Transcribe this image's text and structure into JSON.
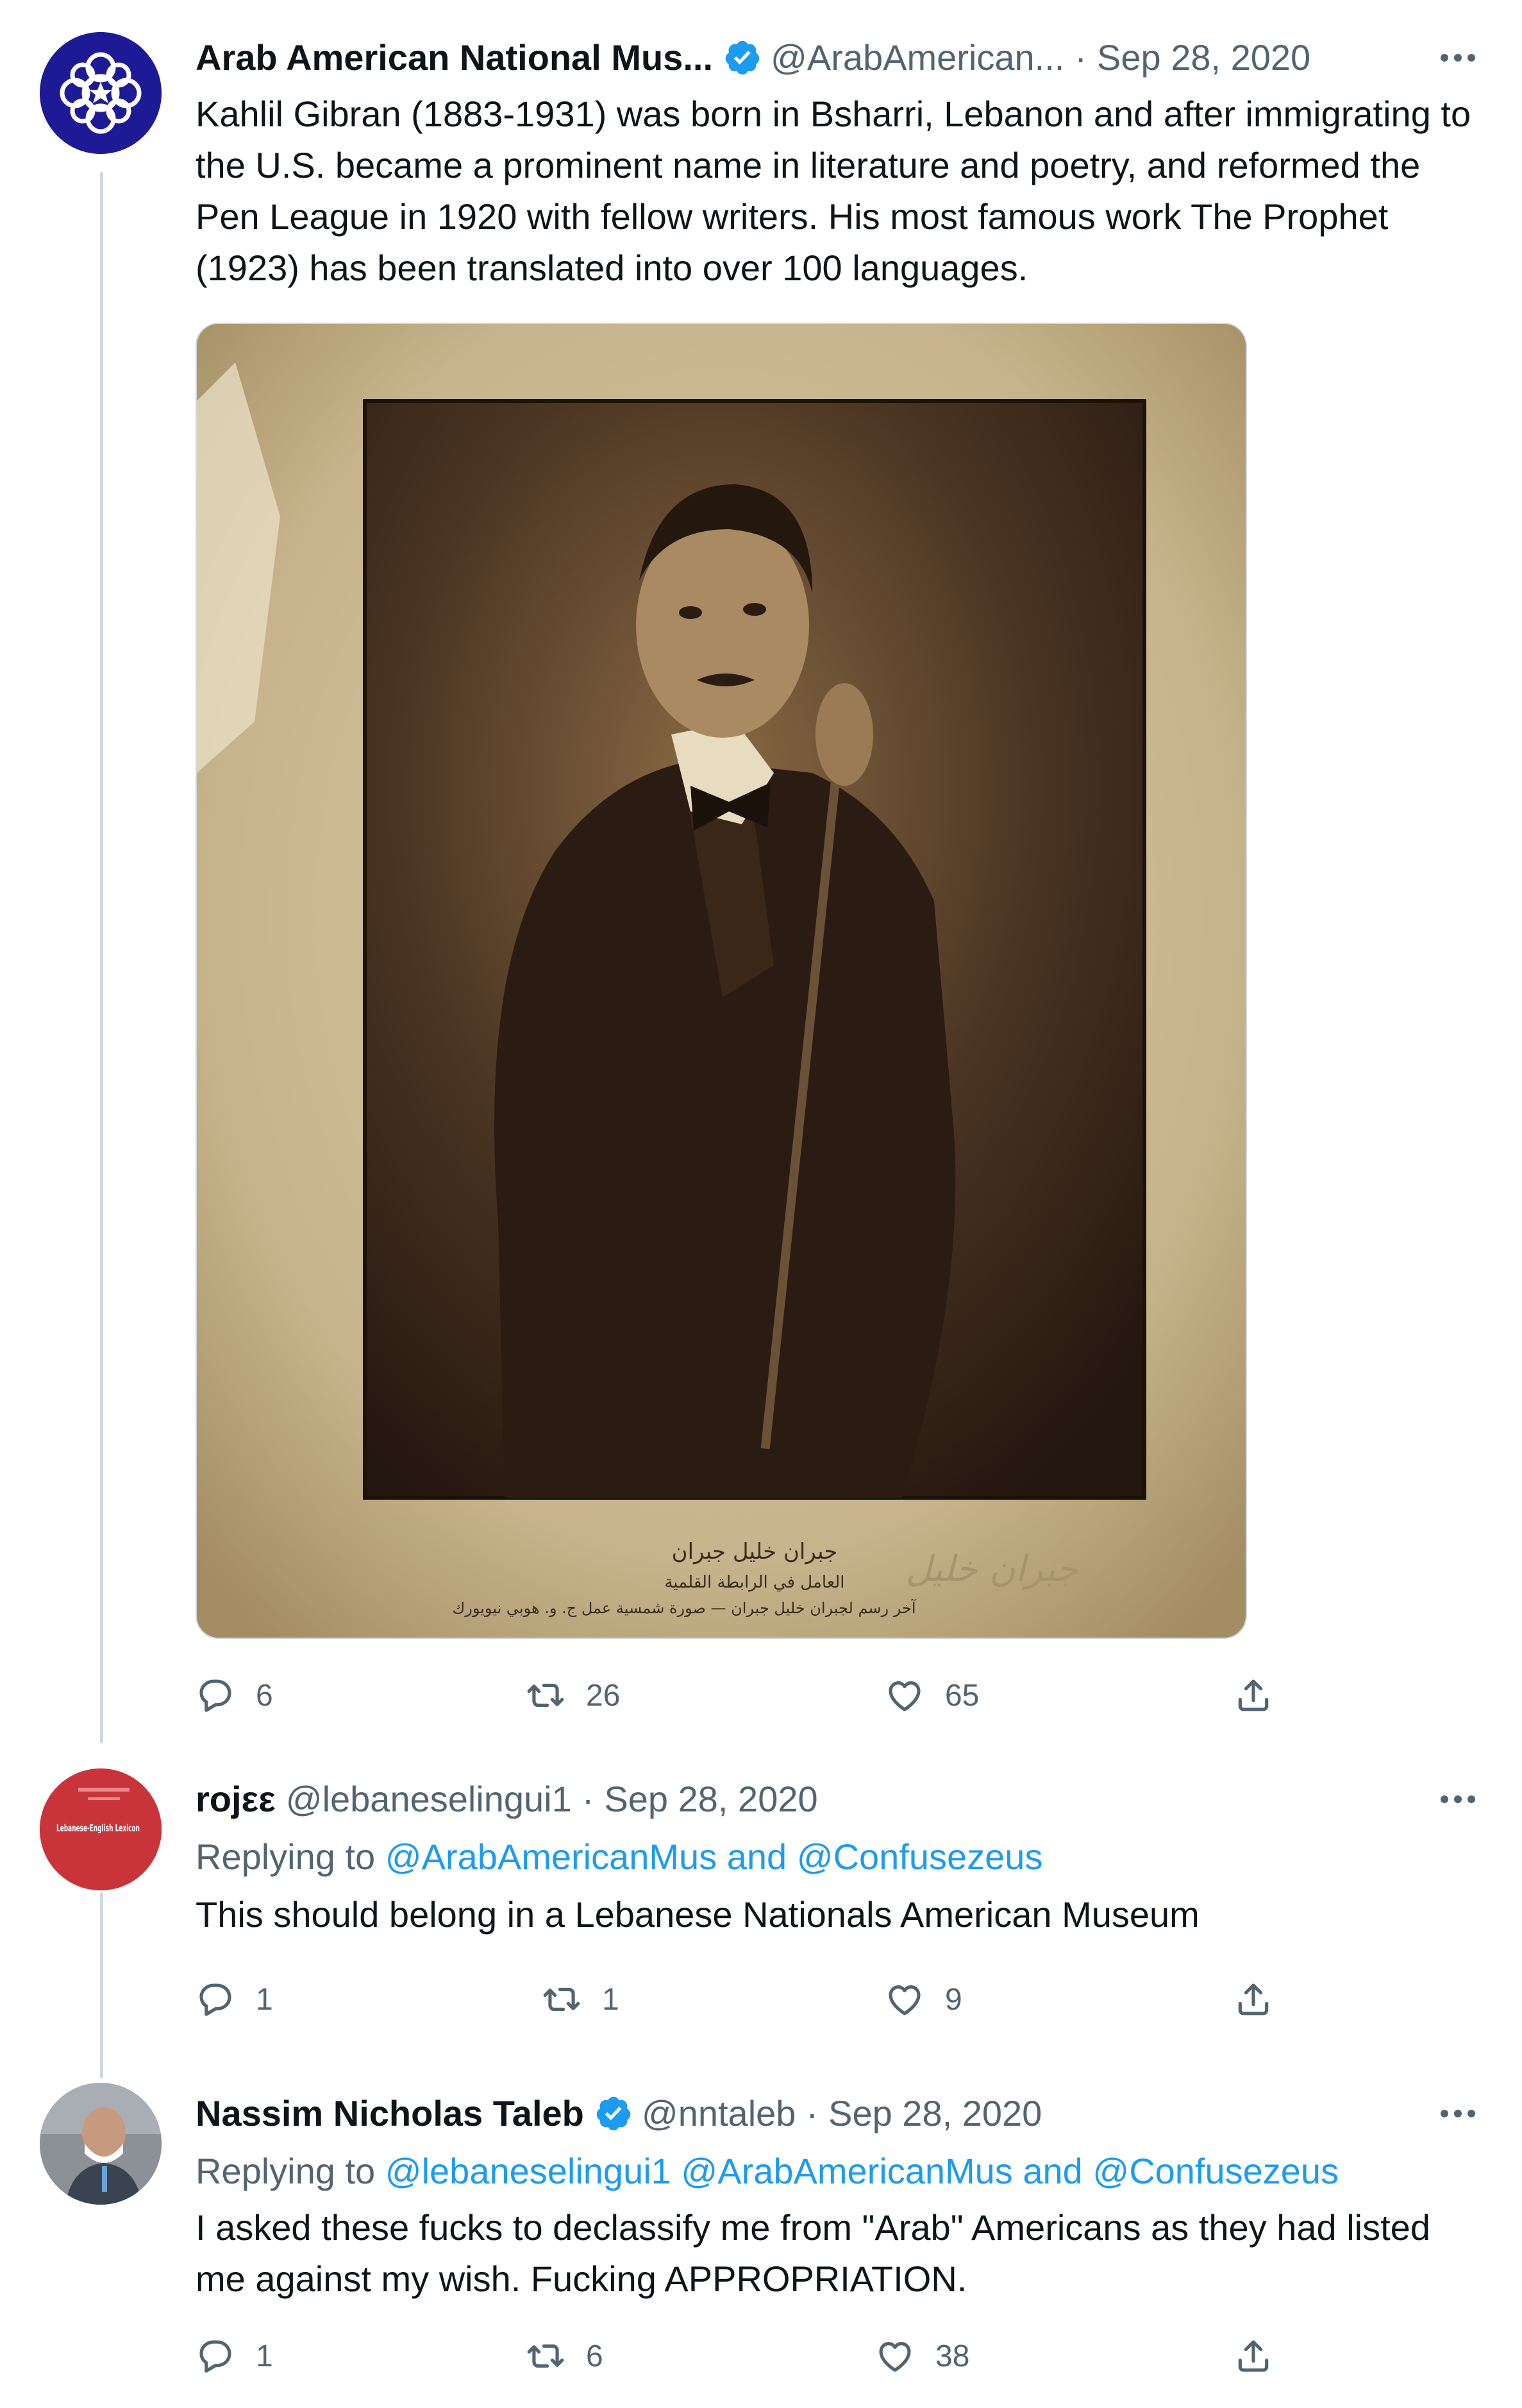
{
  "tweets": [
    {
      "author_name": "Arab American National Mus...",
      "verified": true,
      "handle": "@ArabAmerican...",
      "separator": "·",
      "date": "Sep 28, 2020",
      "text": "Kahlil Gibran (1883-1931) was born in Bsharri, Lebanon and after immigrating to the U.S. became a prominent name in literature and poetry, and reformed the Pen League in 1920 with fellow writers. His most famous work The Prophet (1923) has been translated into over 100 languages.",
      "media": {
        "caption_arabic_line1": "جبران خليل جبران",
        "caption_arabic_line2": "العامل في الرابطة القلمية",
        "caption_arabic_line3": "آخر رسم لجبران خليل جبران — صورة شمسية عمل ج. و. هوبي نيويورك",
        "signature": "جبران خليل"
      },
      "actions": {
        "replies": "6",
        "retweets": "26",
        "likes": "65"
      }
    },
    {
      "author_name": "rojεε",
      "verified": false,
      "handle": "@lebaneselingui1",
      "separator": "·",
      "date": "Sep 28, 2020",
      "replying_label": "Replying to",
      "replying_to": "@ArabAmericanMus and @Confusezeus",
      "text": "This should belong in a Lebanese Nationals American Museum",
      "avatar_text": "Lebanese-English Lexicon",
      "actions": {
        "replies": "1",
        "retweets": "1",
        "likes": "9"
      }
    },
    {
      "author_name": "Nassim Nicholas Taleb",
      "verified": true,
      "handle": "@nntaleb",
      "separator": "·",
      "date": "Sep 28, 2020",
      "replying_label": "Replying to",
      "replying_to": "@lebaneselingui1 @ArabAmericanMus and @Confusezeus",
      "text": "I asked these fucks to declassify me from \"Arab\" Americans as they had listed me against my wish. Fucking APPROPRIATION.",
      "actions": {
        "replies": "1",
        "retweets": "6",
        "likes": "38"
      }
    }
  ],
  "colors": {
    "text": "#0f1419",
    "secondary": "#536471",
    "link": "#1d9bf0",
    "verified": "#1d9bf0",
    "thread_line": "#cfd9de"
  },
  "icons": [
    "more-icon",
    "verified-badge-icon",
    "reply-icon",
    "retweet-icon",
    "like-icon",
    "share-icon"
  ]
}
